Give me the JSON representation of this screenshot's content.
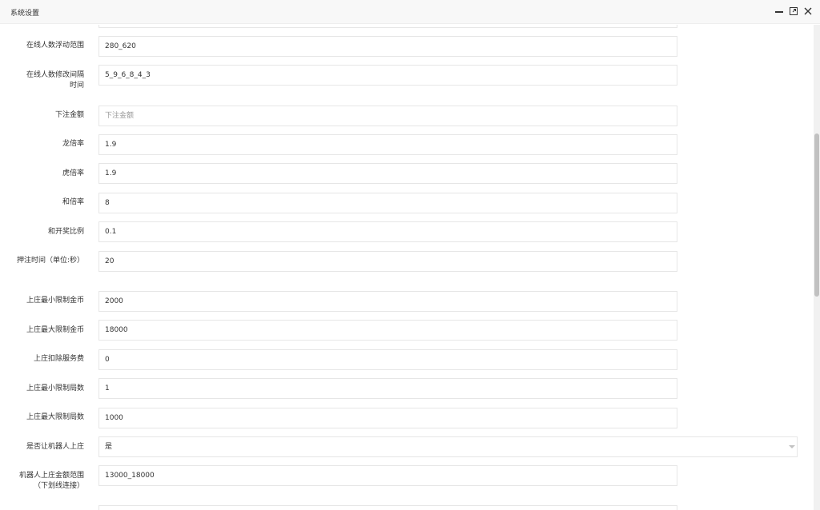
{
  "window": {
    "title": "系统设置"
  },
  "fields": [
    {
      "label": "在线人数浮动范围",
      "value": "280_620"
    },
    {
      "label": "在线人数修改间隔时间",
      "value": "5_9_6_8_4_3"
    },
    {
      "label": "下注金额",
      "value": "",
      "placeholder": "下注金额"
    },
    {
      "label": "龙倍率",
      "value": "1.9"
    },
    {
      "label": "虎倍率",
      "value": "1.9"
    },
    {
      "label": "和倍率",
      "value": "8"
    },
    {
      "label": "和开奖比例",
      "value": "0.1"
    },
    {
      "label": "押注时间（单位:秒）",
      "value": "20"
    },
    {
      "label": "上庄最小限制金币",
      "value": "2000"
    },
    {
      "label": "上庄最大限制金币",
      "value": "18000"
    },
    {
      "label": "上庄扣除服务费",
      "value": "0"
    },
    {
      "label": "上庄最小限制局数",
      "value": "1"
    },
    {
      "label": "上庄最大限制局数",
      "value": "1000"
    },
    {
      "label": "是否让机器人上庄",
      "value": "是"
    },
    {
      "label": "机器人上庄金额范围（下划线连接）",
      "value": "13000_18000"
    }
  ]
}
